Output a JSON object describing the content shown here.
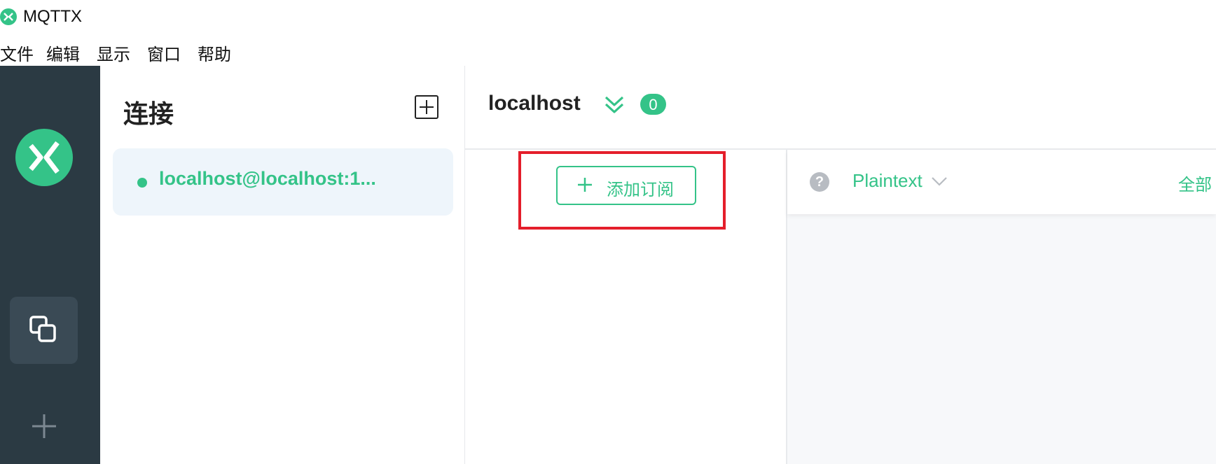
{
  "window": {
    "title": "MQTTX"
  },
  "menu": {
    "items": [
      "文件",
      "编辑",
      "显示",
      "窗口",
      "帮助"
    ]
  },
  "colors": {
    "brand": "#34c388",
    "nav_bg": "#2b3a43",
    "highlight": "#e41e2b"
  },
  "nav": {
    "icons": [
      "mqttx-logo-icon",
      "connections-icon",
      "new-connection-plus-icon"
    ]
  },
  "connections": {
    "title": "连接",
    "items": [
      {
        "name": "localhost@localhost:1...",
        "status": "connected"
      }
    ]
  },
  "main": {
    "host_name": "localhost",
    "badge_count": "0",
    "add_subscription_label": "添加订阅",
    "payload_format": "Plaintext",
    "filter_label": "全部"
  }
}
